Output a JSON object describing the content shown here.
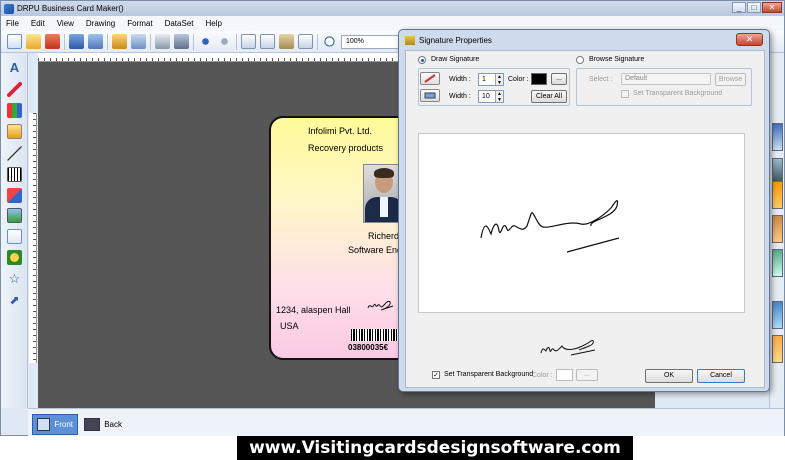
{
  "app": {
    "title": "DRPU Business Card Maker()",
    "window_controls": [
      "_",
      "□",
      "✕"
    ]
  },
  "menu": [
    "File",
    "Edit",
    "View",
    "Drawing",
    "Format",
    "DataSet",
    "Help"
  ],
  "toolbar": {
    "zoom_value": "100%",
    "tool_icons": [
      "new-icon",
      "open-icon",
      "close-icon",
      "save-icon",
      "edit-icon",
      "export-icon",
      "print-icon",
      "database-icon",
      "undo-icon",
      "redo-icon",
      "copy-icon",
      "cut-icon",
      "paste-icon",
      "delete-icon",
      "zoom-in-icon"
    ]
  },
  "toolbox": [
    "text-icon",
    "pencil-icon",
    "library-icon",
    "image-icon",
    "line-icon",
    "barcode-icon",
    "shapes-icon",
    "picture-icon",
    "document-icon",
    "signature-icon",
    "star-icon",
    "arrow-icon"
  ],
  "card": {
    "company": "Infolimi Pvt. Ltd.",
    "tagline": "Recovery products",
    "name": "Richerd",
    "designation": "Software Eng",
    "address": "1234, alaspen Hall",
    "country": "USA",
    "barcode_text": "03800035€"
  },
  "bottom_tabs": {
    "front": "Front",
    "back": "Back"
  },
  "banner": "www.Visitingcardsdesignsoftware.com",
  "dialog": {
    "title": "Signature Properties",
    "close": "✕",
    "draw_signature": "Draw Signature",
    "browse_signature": "Browse Signature",
    "width_label": "Width :",
    "pen_width": "1",
    "eraser_width": "10",
    "color_label": "Color :",
    "color_ellipsis": "...",
    "clear_all": "Clear All",
    "select_label": "Select :",
    "select_value": "Default",
    "browse_button": "Browse",
    "set_transparent_top": "Set Transparent Background",
    "set_transparent_bottom": "Set Transparent Background",
    "bottom_color_label": "Color :",
    "bottom_ellipsis": "...",
    "ok": "OK",
    "cancel": "Cancel",
    "pen_color": "#000000",
    "bottom_color": "#ffffff"
  }
}
